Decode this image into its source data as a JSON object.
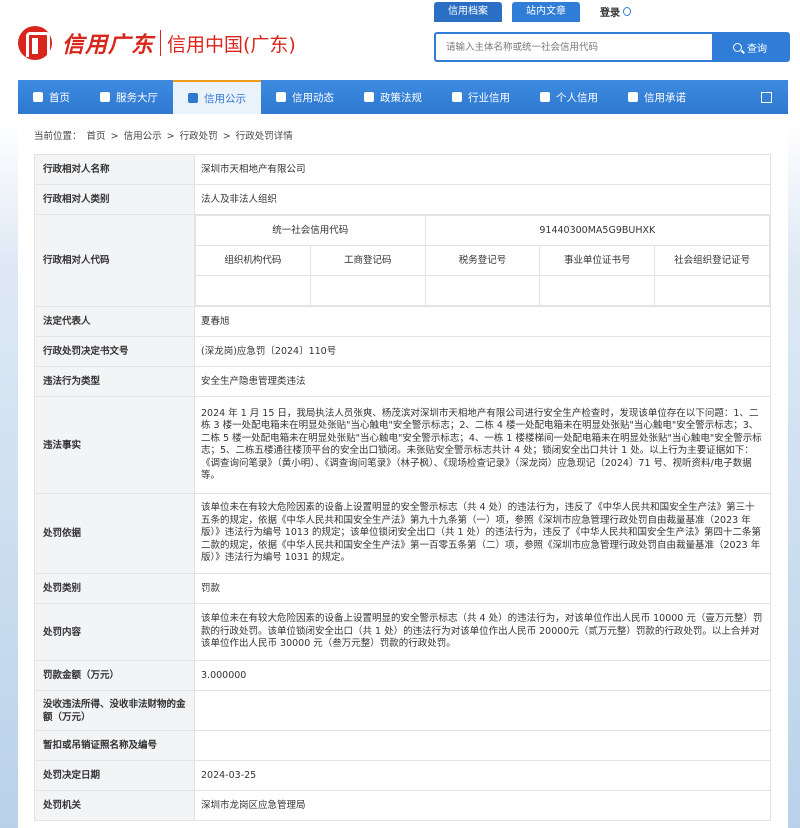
{
  "header": {
    "logo_script": "信用广东",
    "logo_title": "信用中国(广东)",
    "top_tabs": [
      "信用档案",
      "站内文章"
    ],
    "login": "登录",
    "search_placeholder": "请输入主体名称或统一社会信用代码",
    "search_button": "查询"
  },
  "nav": {
    "items": [
      {
        "label": "首页",
        "icon": "home-icon"
      },
      {
        "label": "服务大厅",
        "icon": "grid-icon"
      },
      {
        "label": "信用公示",
        "icon": "building-icon"
      },
      {
        "label": "信用动态",
        "icon": "document-icon"
      },
      {
        "label": "政策法规",
        "icon": "book-icon"
      },
      {
        "label": "行业信用",
        "icon": "chart-icon"
      },
      {
        "label": "个人信用",
        "icon": "id-card-icon"
      },
      {
        "label": "信用承诺",
        "icon": "shield-icon"
      }
    ],
    "share_icon": "share-icon",
    "active_index": 2
  },
  "breadcrumb": [
    "当前位置：",
    "首页",
    ">",
    "信用公示",
    ">",
    "行政处罚",
    ">",
    "行政处罚详情"
  ],
  "record": {
    "subject_name_label": "行政相对人名称",
    "subject_name": "深圳市天相地产有限公司",
    "subject_type_label": "行政相对人类别",
    "subject_type": "法人及非法人组织",
    "subject_code_label": "行政相对人代码",
    "codes": {
      "uscc_label": "统一社会信用代码",
      "uscc": "91440300MA5G9BUHXK",
      "headers": [
        "组织机构代码",
        "工商登记码",
        "税务登记号",
        "事业单位证书号",
        "社会组织登记证号"
      ],
      "values": [
        "",
        "",
        "",
        "",
        ""
      ]
    },
    "legal_rep_label": "法定代表人",
    "legal_rep": "夏春旭",
    "doc_no_label": "行政处罚决定书文号",
    "doc_no": "(深龙岗)应急罚〔2024〕110号",
    "violation_type_label": "违法行为类型",
    "violation_type": "安全生产隐患管理类违法",
    "facts_label": "违法事实",
    "facts": "2024 年 1 月 15 日，我局执法人员张爽、杨茂滨对深圳市天相地产有限公司进行安全生产检查时，发现该单位存在以下问题：1、二栋 3 楼一处配电箱未在明显处张贴\"当心触电\"安全警示标志；2、二栋 4 楼一处配电箱未在明显处张贴\"当心触电\"安全警示标志；3、二栋 5 楼一处配电箱未在明显处张贴\"当心触电\"安全警示标志；4、一栋 1 楼楼梯间一处配电箱未在明显处张贴\"当心触电\"安全警示标志；5、二栋五楼通往楼顶平台的安全出口锁闭。未张贴安全警示标志共计 4 处；锁闭安全出口共计 1 处。以上行为主要证据如下：《调查询问笔录》（黄小明）、《调查询问笔录》（林子枫）、《现场检查记录》（深龙岗）应急现记〔2024〕71 号、视听资料/电子数据等。",
    "basis_label": "处罚依据",
    "basis": "该单位未在有较大危险因素的设备上设置明显的安全警示标志（共 4 处）的违法行为，违反了《中华人民共和国安全生产法》第三十五条的规定，依据《中华人民共和国安全生产法》第九十九条第（一）项，参照《深圳市应急管理行政处罚自由裁量基准（2023 年版）》违法行为编号 1013 的规定；该单位锁闭安全出口（共 1 处）的违法行为，违反了《中华人民共和国安全生产法》第四十二条第二款的规定，依据《中华人民共和国安全生产法》第一百零五条第（二）项，参照《深圳市应急管理行政处罚自由裁量基准（2023 年版）》违法行为编号 1031 的规定。",
    "category_label": "处罚类别",
    "category": "罚款",
    "content_label": "处罚内容",
    "content": "该单位未在有较大危险因素的设备上设置明显的安全警示标志（共 4 处）的违法行为，对该单位作出人民币 10000 元（壹万元整）罚款的行政处罚。该单位锁闭安全出口（共 1 处）的违法行为对该单位作出人民币 20000元（贰万元整）罚款的行政处罚。以上合并对该单位作出人民币 30000 元（叁万元整）罚款的行政处罚。",
    "fine_label": "罚款金额（万元）",
    "fine": "3.000000",
    "confiscation_label": "没收违法所得、没收非法财物的金额（万元）",
    "confiscation": "",
    "license_label": "暂扣或吊销证照名称及编号",
    "license": "",
    "decision_date_label": "处罚决定日期",
    "decision_date": "2024-03-25",
    "authority_label": "处罚机关",
    "authority": "深圳市龙岗区应急管理局"
  }
}
